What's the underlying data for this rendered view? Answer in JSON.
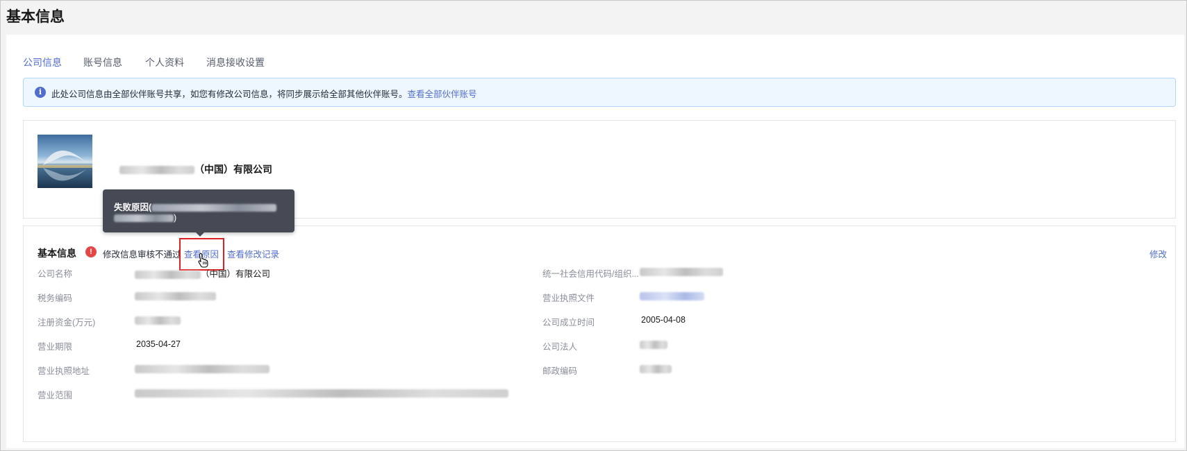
{
  "page": {
    "title": "基本信息"
  },
  "tabs": [
    {
      "label": "公司信息",
      "active": true
    },
    {
      "label": "账号信息",
      "active": false
    },
    {
      "label": "个人资料",
      "active": false
    },
    {
      "label": "消息接收设置",
      "active": false
    }
  ],
  "notice": {
    "icon": "info-icon",
    "text": "此处公司信息由全部伙伴账号共享，如您有修改公司信息，将同步展示给全部其他伙伴账号。",
    "link": "查看全部伙伴账号"
  },
  "company": {
    "name_suffix": "（中国）有限公司"
  },
  "tooltip": {
    "title_prefix": "失败原因(",
    "close_paren": ")"
  },
  "basic_info": {
    "title": "基本信息",
    "status_icon": "exclamation-icon",
    "status_text": "修改信息审核不通过",
    "view_reason": "查看原因",
    "view_history": "查看修改记录",
    "edit": "修改",
    "fields_left": [
      {
        "label": "公司名称",
        "value": "（中国）有限公司"
      },
      {
        "label": "税务编码",
        "value": ""
      },
      {
        "label": "注册资金(万元)",
        "value": ""
      },
      {
        "label": "营业期限",
        "value": "2035-04-27"
      },
      {
        "label": "营业执照地址",
        "value": ""
      },
      {
        "label": "营业范围",
        "value": ""
      }
    ],
    "fields_right": [
      {
        "label": "统一社会信用代码/组织...",
        "value": ""
      },
      {
        "label": "营业执照文件",
        "value": ""
      },
      {
        "label": "公司成立时间",
        "value": "2005-04-08"
      },
      {
        "label": "公司法人",
        "value": ""
      },
      {
        "label": "邮政编码",
        "value": ""
      }
    ]
  },
  "colors": {
    "accent": "#526ecc",
    "error": "#e54545",
    "highlight": "#e02020"
  }
}
